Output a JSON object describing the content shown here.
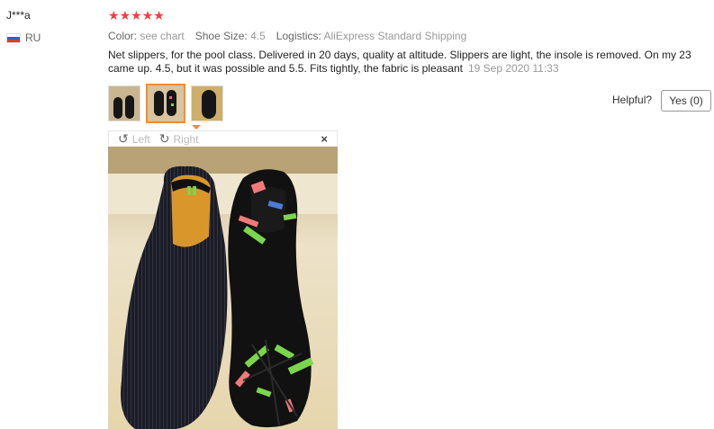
{
  "reviewer": {
    "name": "J***a",
    "country": "RU"
  },
  "rating": {
    "stars": 5,
    "star_color": "#ef4040"
  },
  "meta": {
    "color_label": "Color:",
    "color_value": "see chart",
    "size_label": "Shoe Size:",
    "size_value": "4.5",
    "logistics_label": "Logistics:",
    "logistics_value": "AliExpress Standard Shipping"
  },
  "review": {
    "text": "Net slippers, for the pool class. Delivered in 20 days, quality at altitude. Slippers are light, the insole is removed. On my 23 came up. 4.5, but it was possible and 5.5. Fits tightly, the fabric is pleasant",
    "date": "19 Sep 2020 11:33"
  },
  "helpful": {
    "label": "Helpful?",
    "yes_button": "Yes (0)"
  },
  "viewer": {
    "rotate_left": "Left",
    "rotate_right": "Right",
    "close": "×"
  },
  "accent_color": "#f08c36"
}
